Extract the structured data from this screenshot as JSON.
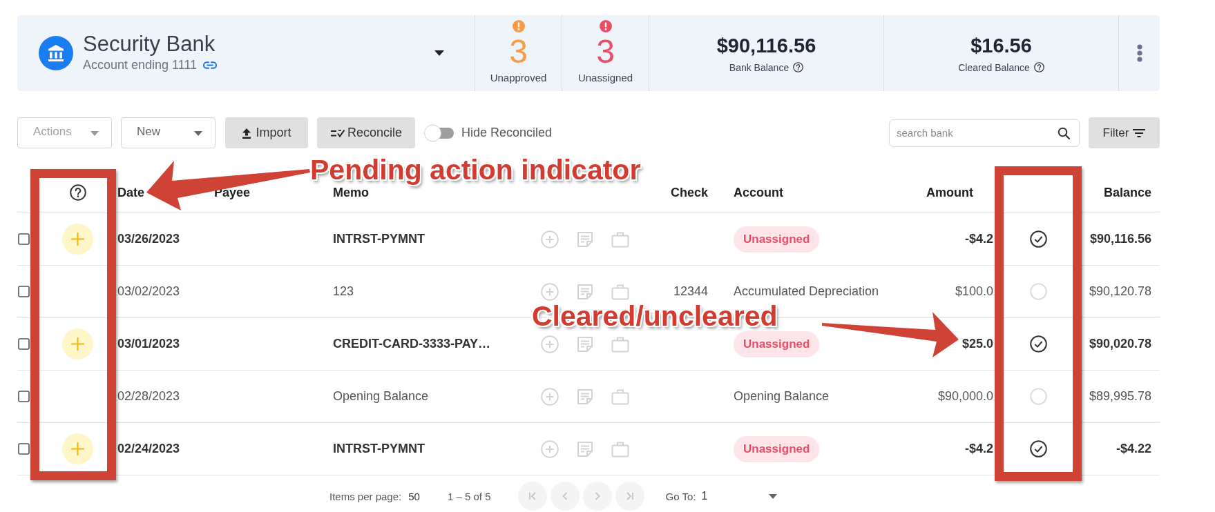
{
  "account": {
    "name": "Security Bank",
    "subtitle": "Account ending 1111"
  },
  "stats": [
    {
      "kind": "count",
      "value": "3",
      "label": "Unapproved",
      "color": "#f79b44"
    },
    {
      "kind": "count",
      "value": "3",
      "label": "Unassigned",
      "color": "#ea4d66"
    },
    {
      "kind": "balance",
      "value": "$90,116.56",
      "label": "Bank Balance"
    },
    {
      "kind": "balance",
      "value": "$16.56",
      "label": "Cleared Balance"
    }
  ],
  "toolbar": {
    "dropdowns": [
      {
        "label": "Actions",
        "disabled": true
      },
      {
        "label": "New",
        "disabled": false
      }
    ],
    "buttons": [
      {
        "kind": "import",
        "label": "Import"
      },
      {
        "kind": "reconcile",
        "label": "Reconcile"
      }
    ],
    "toggle": {
      "label": "Hide Reconciled",
      "on": false
    },
    "search": {
      "placeholder": "search bank"
    },
    "filter": {
      "label": "Filter"
    }
  },
  "table": {
    "columns": {
      "date": "Date",
      "payee": "Payee",
      "memo": "Memo",
      "check": "Check",
      "account": "Account",
      "amount": "Amount",
      "balance": "Balance"
    },
    "rows": [
      {
        "checked": false,
        "pending": true,
        "date": "03/26/2023",
        "memo": "INTRST-PYMNT",
        "account": {
          "kind": "tag",
          "text": "Unassigned"
        },
        "amount": "-$4.2",
        "cleared": true,
        "balance": "$90,116.56"
      },
      {
        "checked": false,
        "pending": false,
        "date": "03/02/2023",
        "memo": "123",
        "check": "12344",
        "account": {
          "kind": "text",
          "text": "Accumulated Depreciation"
        },
        "amount": "$100.0",
        "cleared": false,
        "balance": "$90,120.78"
      },
      {
        "checked": false,
        "pending": true,
        "date": "03/01/2023",
        "memo": "CREDIT-CARD-3333-PAY…",
        "account": {
          "kind": "tag",
          "text": "Unassigned"
        },
        "amount": "$25.0",
        "cleared": true,
        "balance": "$90,020.78"
      },
      {
        "checked": false,
        "pending": false,
        "date": "02/28/2023",
        "memo": "Opening Balance",
        "account": {
          "kind": "text",
          "text": "Opening Balance"
        },
        "amount": "$90,000.0",
        "cleared": false,
        "balance": "$89,995.78"
      },
      {
        "checked": false,
        "pending": true,
        "date": "02/24/2023",
        "memo": "INTRST-PYMNT",
        "account": {
          "kind": "tag",
          "text": "Unassigned"
        },
        "amount": "-$4.2",
        "cleared": true,
        "balance": "-$4.22"
      }
    ]
  },
  "pagination": {
    "items_per_page_label": "Items per page:",
    "items_per_page": "50",
    "range": "1 – 5 of 5",
    "pager_buttons": [
      {
        "kind": "first",
        "disabled": true
      },
      {
        "kind": "previous",
        "disabled": true
      },
      {
        "kind": "next",
        "disabled": true
      },
      {
        "kind": "last",
        "disabled": true
      }
    ],
    "goto_label": "Go To:",
    "goto_value": "1"
  },
  "annotations": [
    {
      "kind": "pending",
      "text": "Pending action indicator"
    },
    {
      "kind": "cleared",
      "text": "Cleared/uncleared"
    }
  ]
}
